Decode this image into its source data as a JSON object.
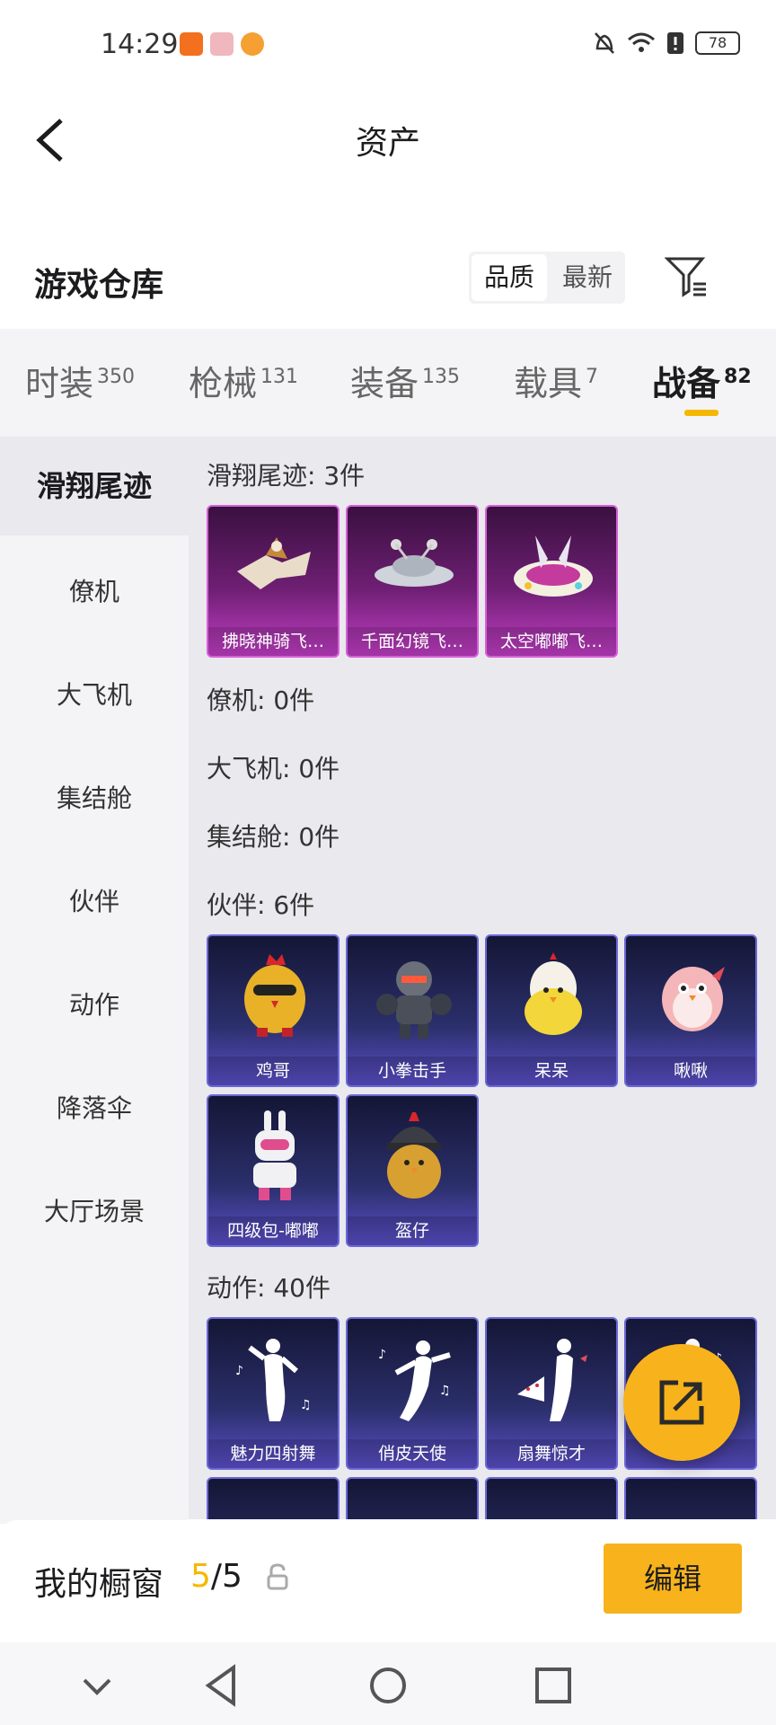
{
  "status_bar": {
    "time": "14:29",
    "battery": "78"
  },
  "header": {
    "title": "资产"
  },
  "warehouse": {
    "title": "游戏仓库",
    "sort": [
      {
        "label": "品质"
      },
      {
        "label": "最新"
      }
    ]
  },
  "tabs": [
    {
      "label": "时装",
      "count": "350"
    },
    {
      "label": "枪械",
      "count": "131"
    },
    {
      "label": "装备",
      "count": "135"
    },
    {
      "label": "载具",
      "count": "7"
    },
    {
      "label": "战备",
      "count": "82"
    }
  ],
  "sidebar": [
    {
      "label": "滑翔尾迹"
    },
    {
      "label": "僚机"
    },
    {
      "label": "大飞机"
    },
    {
      "label": "集结舱"
    },
    {
      "label": "伙伴"
    },
    {
      "label": "动作"
    },
    {
      "label": "降落伞"
    },
    {
      "label": "大厅场景"
    }
  ],
  "groups": {
    "glide": {
      "label": "滑翔尾迹: 3件",
      "items": [
        "拂晓神骑飞…",
        "千面幻镜飞…",
        "太空嘟嘟飞…"
      ]
    },
    "wingman": {
      "label": "僚机: 0件"
    },
    "plane": {
      "label": "大飞机: 0件"
    },
    "pod": {
      "label": "集结舱: 0件"
    },
    "partner": {
      "label": "伙伴: 6件",
      "items": [
        "鸡哥",
        "小拳击手",
        "呆呆",
        "啾啾",
        "四级包-嘟嘟",
        "盔仔"
      ]
    },
    "emote": {
      "label": "动作: 40件",
      "items": [
        "魅力四射舞",
        "俏皮天使",
        "扇舞惊才",
        ""
      ]
    }
  },
  "showcase": {
    "title": "我的橱窗",
    "current": "5",
    "total": "/5",
    "edit": "编辑"
  },
  "colors": {
    "accent": "#f5b800",
    "purple_card": "#6e1f73",
    "indigo_card": "#2b2f6b"
  }
}
